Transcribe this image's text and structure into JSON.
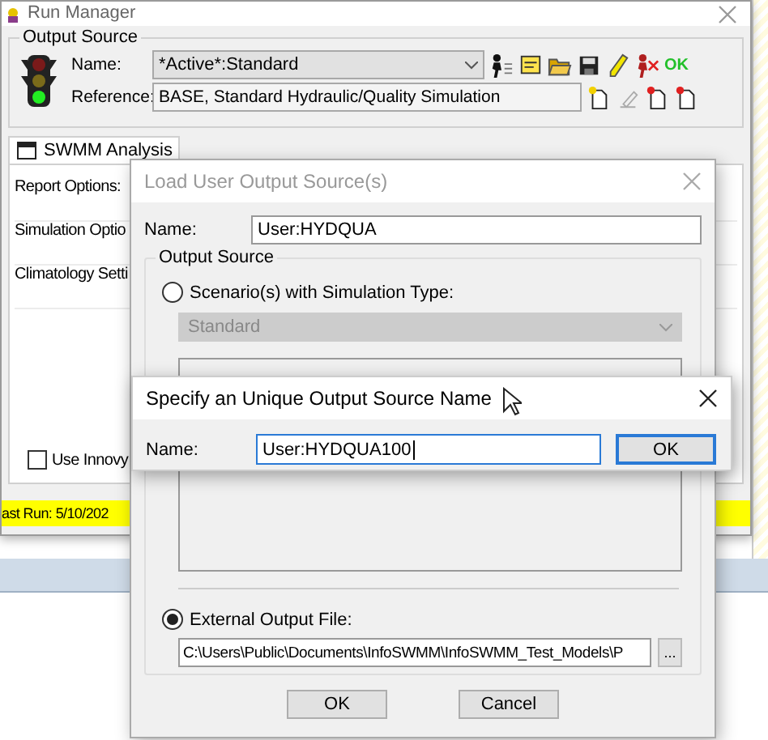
{
  "run_manager": {
    "title": "Run Manager",
    "output_source": {
      "legend": "Output Source",
      "name_label": "Name:",
      "name_value": "*Active*:Standard",
      "reference_label": "Reference:",
      "reference_value": "BASE, Standard Hydraulic/Quality Simulation",
      "ok_label": "OK"
    },
    "tabs": [
      {
        "label": "SWMM Analysis",
        "selected": true
      }
    ],
    "options": [
      "Report Options:",
      "Simulation Optio",
      "Climatology Setti"
    ],
    "checkbox": {
      "label": "Use Innovy",
      "checked": false
    },
    "status": "ast Run: 5/10/202"
  },
  "load_dialog": {
    "title": "Load User Output Source(s)",
    "name_label": "Name:",
    "name_value": "User:HYDQUA",
    "group_legend": "Output Source",
    "sources": [
      {
        "kind": "scenario",
        "label": "Scenario(s) with Simulation Type:",
        "selected": false,
        "type_value": "Standard"
      },
      {
        "kind": "file",
        "label": "External Output File:",
        "selected": true,
        "path": "C:\\Users\\Public\\Documents\\InfoSWMM\\InfoSWMM_Test_Models\\P",
        "browse": "..."
      }
    ],
    "buttons": [
      "OK",
      "Cancel"
    ]
  },
  "name_dialog": {
    "title": "Specify an Unique Output Source Name",
    "name_label": "Name:",
    "value": "User:HYDQUA100",
    "button": "OK"
  }
}
